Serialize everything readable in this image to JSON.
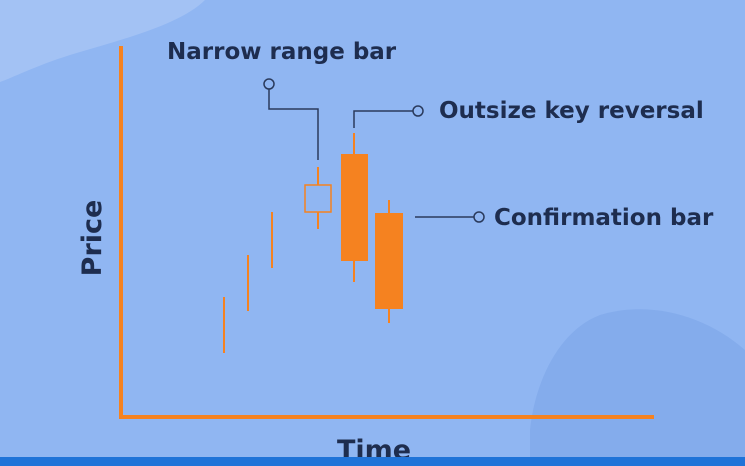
{
  "labels": {
    "narrow_range_bar": "Narrow range bar",
    "outsize_key_reversal": "Outsize key reversal",
    "confirmation_bar": "Confirmation bar"
  },
  "axes": {
    "y_label": "Price",
    "x_label": "Time"
  },
  "colors": {
    "background": "#90b6f2",
    "blob": "#a3c2f4",
    "blob_dark": "#84acec",
    "accent": "#f58220",
    "text": "#1e2d4f",
    "leader_line": "#2a3a5c",
    "bottom_bar": "#1f73d8"
  }
}
